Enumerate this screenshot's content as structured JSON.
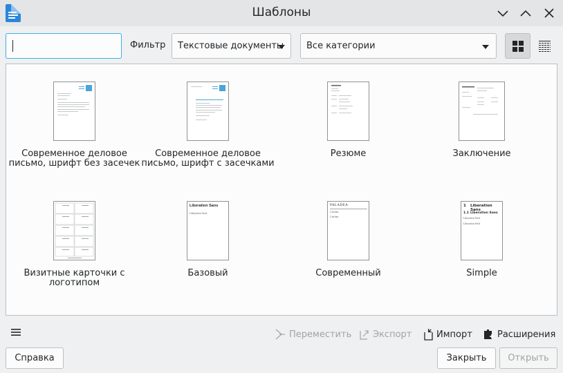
{
  "window": {
    "title": "Шаблоны"
  },
  "filter": {
    "search_value": "",
    "filter_label": "Фильтр",
    "doc_type_value": "Текстовые документы",
    "category_value": "Все категории"
  },
  "templates": [
    {
      "label": "Современное деловое письмо, шрифт без засечек"
    },
    {
      "label": "Современное деловое письмо, шрифт с засечками"
    },
    {
      "label": "Резюме"
    },
    {
      "label": "Заключение"
    },
    {
      "label": "Визитные карточки с логотипом"
    },
    {
      "label": "Базовый",
      "preview_lines": [
        "Liberation Sans",
        "Liberation Serif"
      ]
    },
    {
      "label": "Современный",
      "preview_lines": [
        "PALADEA",
        "Caribo",
        "Caribo"
      ]
    },
    {
      "label": "Simple",
      "preview_lines": [
        "1",
        "Liberation Sans",
        "1.1",
        "Liberation Sans",
        "Liberation Serif",
        "Liberation Serif"
      ]
    }
  ],
  "actions": {
    "move_label": "Переместить",
    "export_label": "Экспорт",
    "import_label": "Импорт",
    "extensions_label": "Расширения"
  },
  "buttons": {
    "help_label": "Справка",
    "close_label": "Закрыть",
    "open_label": "Открыть"
  },
  "colors": {
    "accent": "#3daee9",
    "brand_icon": "#2a86d9",
    "disabled_text": "#a1a3a5"
  }
}
